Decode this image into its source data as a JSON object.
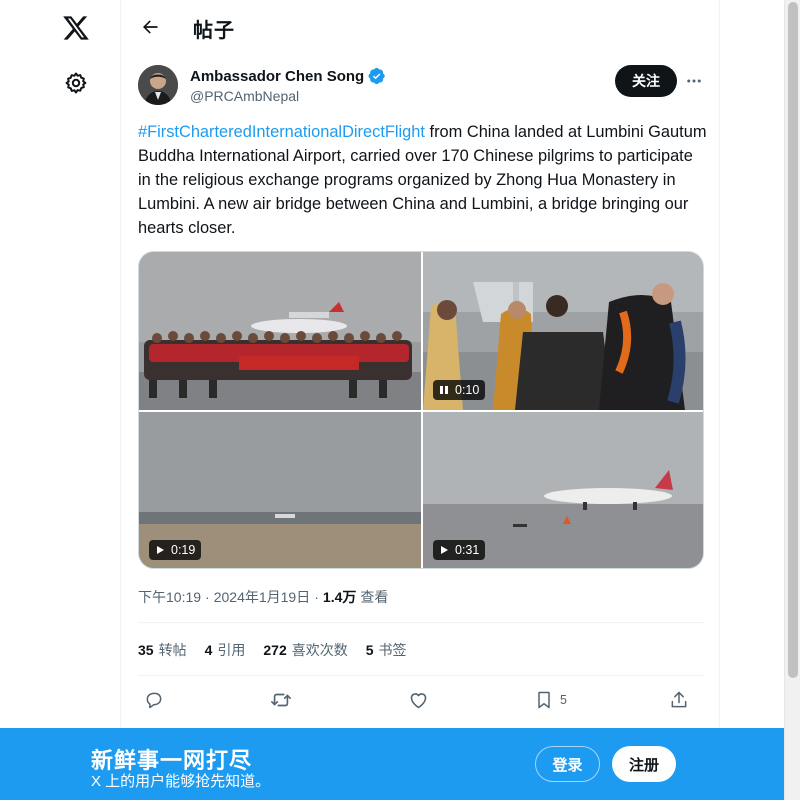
{
  "nav": {
    "logo_icon": "x-logo-icon",
    "settings_icon": "gear-icon"
  },
  "header": {
    "back_icon": "arrow-left-icon",
    "title": "帖子"
  },
  "author": {
    "name": "Ambassador Chen Song",
    "handle": "@PRCAmbNepal",
    "verified_color": "#1d9bf0",
    "follow_label": "关注"
  },
  "tweet": {
    "hashtag": "#FirstCharteredInternationalDirectFlight",
    "body": " from China landed at Lumbini Gautum Buddha International Airport, carried over 170 Chinese pilgrims to participate in the religious exchange programs organized by Zhong Hua Monastery in Lumbini. A new air bridge between China and Lumbini, a bridge bringing our hearts closer."
  },
  "media": [
    {
      "kind": "photo",
      "desc": "group-photo"
    },
    {
      "kind": "video",
      "duration": "0:10",
      "state": "playing",
      "icon": "pause-icon"
    },
    {
      "kind": "video",
      "duration": "0:19",
      "state": "paused",
      "icon": "play-icon"
    },
    {
      "kind": "video",
      "duration": "0:31",
      "state": "paused",
      "icon": "play-icon"
    }
  ],
  "meta": {
    "time": "下午10:19",
    "sep1": "·",
    "date": "2024年1月19日",
    "sep2": "·",
    "views_count": "1.4万",
    "views_label": "查看"
  },
  "stats": [
    {
      "num": "35",
      "label": "转帖"
    },
    {
      "num": "4",
      "label": "引用"
    },
    {
      "num": "272",
      "label": "喜欢次数"
    },
    {
      "num": "5",
      "label": "书签"
    }
  ],
  "actions": {
    "reply_icon": "reply-icon",
    "repost_icon": "repost-icon",
    "like_icon": "heart-icon",
    "bookmark_icon": "bookmark-icon",
    "bookmark_count": "5",
    "share_icon": "share-icon"
  },
  "banner": {
    "title": "新鲜事一网打尽",
    "subtitle": "X 上的用户能够抢先知道。",
    "login_label": "登录",
    "signup_label": "注册",
    "color": "#1d9bf0"
  }
}
